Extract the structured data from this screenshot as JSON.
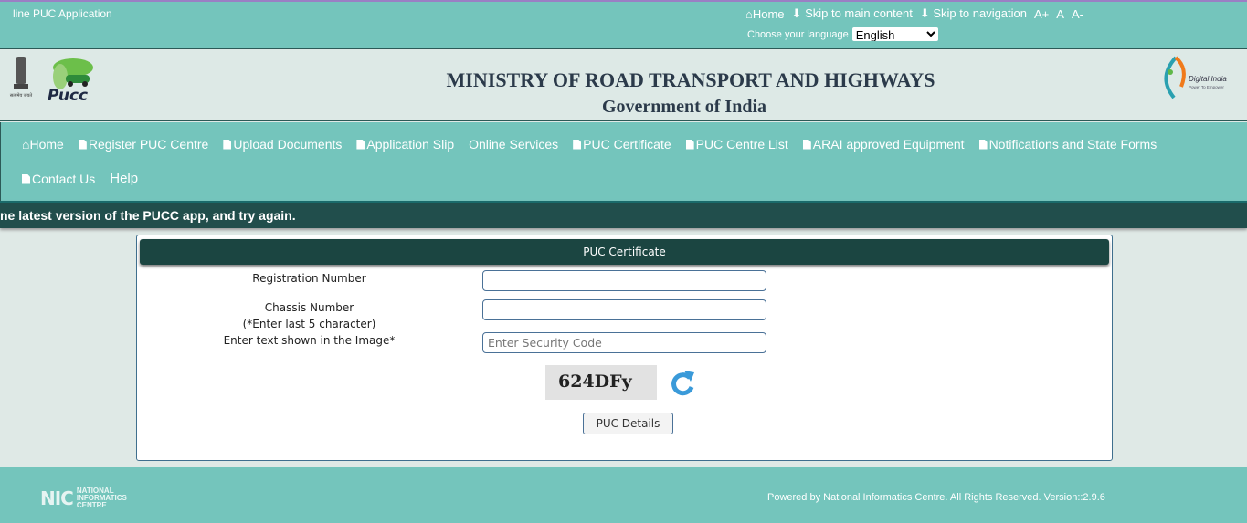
{
  "topbar": {
    "app_title": "line PUC Application",
    "links": [
      "Home",
      "Skip to main content",
      "Skip to navigation"
    ],
    "font_sizes": [
      "A+",
      "A",
      "A-"
    ],
    "language_label": "Choose your language",
    "language_value": "English"
  },
  "header": {
    "title": "MINISTRY OF ROAD TRANSPORT AND HIGHWAYS",
    "subtitle": "Government of India",
    "logo_left": "PUCC",
    "logo_right": "Digital India - Power To Empower",
    "emblem_text": "सत्यमेव जयते"
  },
  "nav": {
    "items": [
      "Home",
      "Register PUC Centre",
      "Upload Documents",
      "Application Slip",
      "Online Services",
      "PUC Certificate",
      "PUC Centre List",
      "ARAI approved Equipment",
      "Notifications and State Forms",
      "Contact Us",
      "Help"
    ]
  },
  "marquee": "ne latest version of the PUCC app, and try again.",
  "form": {
    "title": "PUC Certificate",
    "reg_label": "Registration Number",
    "chassis_label": "Chassis Number",
    "chassis_hint": "(*Enter last 5 character)",
    "captcha_label": "Enter text shown in the Image*",
    "captcha_placeholder": "Enter Security Code",
    "captcha_text": "624DFy",
    "submit": "PUC Details"
  },
  "footer": {
    "nic_logo": "NIC NATIONAL INFORMATICS CENTRE",
    "text": "Powered by National Informatics Centre. All Rights Reserved. Version::2.9.6"
  },
  "colors": {
    "teal": "#74c5bc",
    "dark": "#1b4541",
    "accent_refresh": "#3a9ad9"
  }
}
